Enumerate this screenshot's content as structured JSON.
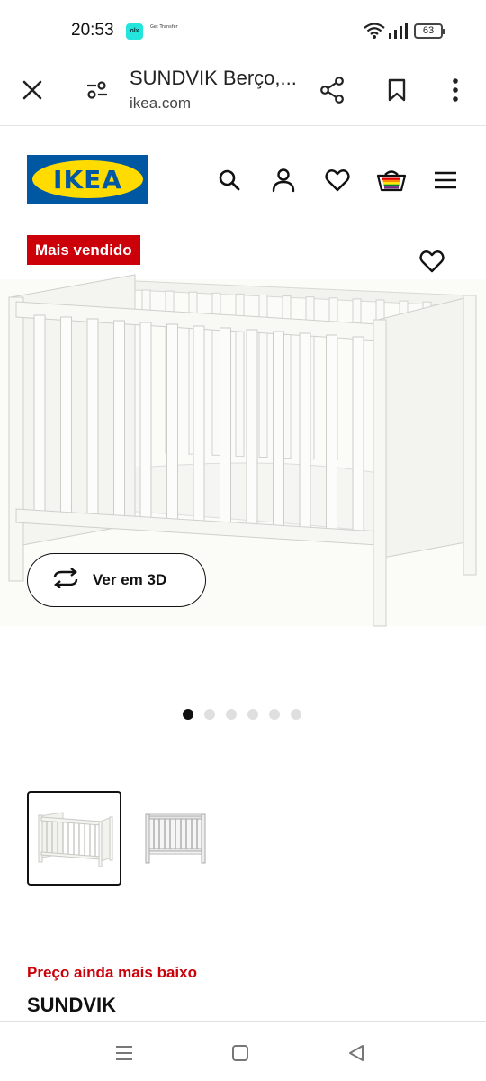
{
  "status_bar": {
    "time": "20:53",
    "app_badge": "olx",
    "app_label": "Get Transfer",
    "battery": "63",
    "icons": [
      "olx-icon",
      "wifi-icon",
      "signal-icon",
      "battery-icon"
    ]
  },
  "browser": {
    "title": "SUNDVIK Berço,...",
    "domain": "ikea.com",
    "icons": [
      "close-icon",
      "site-settings-icon",
      "share-icon",
      "bookmark-icon",
      "more-vert-icon"
    ]
  },
  "ikea_header": {
    "logo_text": "IKEA",
    "colors": {
      "brand_blue": "#0058a3",
      "brand_yellow": "#ffdb00"
    },
    "icons": [
      "search-icon",
      "account-icon",
      "wishlist-icon",
      "cart-icon",
      "menu-icon"
    ]
  },
  "product": {
    "badge": "Mais vendido",
    "badge_color": "#cc0008",
    "view_3d_label": "Ver em 3D",
    "carousel": {
      "count": 6,
      "active": 0
    },
    "thumbnails": [
      {
        "selected": true
      },
      {
        "selected": false
      }
    ],
    "price_note": "Preço ainda mais baixo",
    "name": "SUNDVIK"
  },
  "android_nav": {
    "icons": [
      "recents-icon",
      "home-icon",
      "back-icon"
    ]
  }
}
